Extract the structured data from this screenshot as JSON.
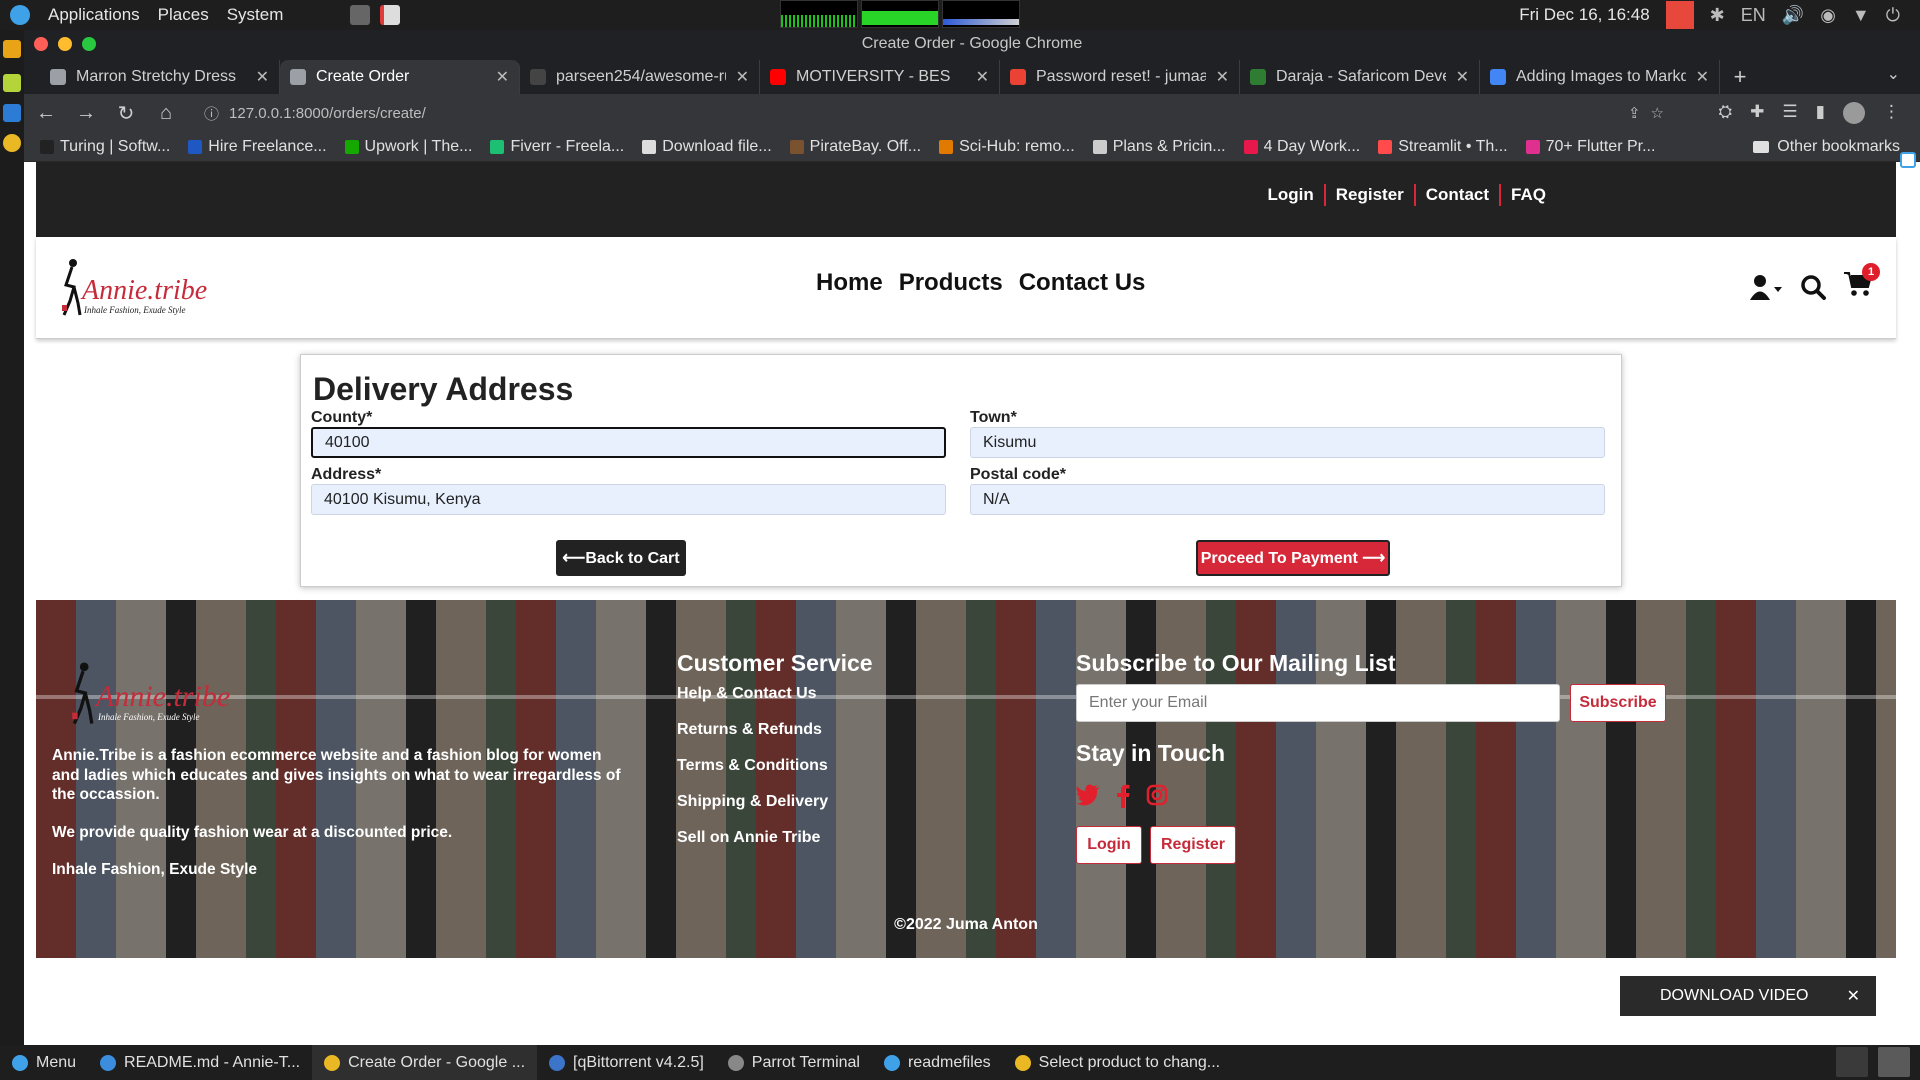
{
  "os_panel": {
    "menu": [
      "Applications",
      "Places",
      "System"
    ],
    "clock": "Fri Dec 16, 16:48",
    "lang": "EN"
  },
  "window": {
    "title": "Create Order - Google Chrome"
  },
  "tabs": [
    {
      "label": "Marron Stretchy Dress",
      "active": false,
      "color": "#9aa0a6"
    },
    {
      "label": "Create Order",
      "active": true,
      "color": "#9aa0a6"
    },
    {
      "label": "parseen254/awesome-ru",
      "active": false,
      "color": "#444444"
    },
    {
      "label": "MOTIVERSITY - BES",
      "active": false,
      "color": "#ff0000"
    },
    {
      "label": "Password reset! - jumaa",
      "active": false,
      "color": "#ea4335"
    },
    {
      "label": "Daraja - Safaricom Devel",
      "active": false,
      "color": "#2e7d32"
    },
    {
      "label": "Adding Images to Markd",
      "active": false,
      "color": "#4285f4"
    }
  ],
  "address_bar": {
    "url": "127.0.0.1:8000/orders/create/"
  },
  "bookmarks": [
    {
      "label": "Turing | Softw...",
      "color": "#222222"
    },
    {
      "label": "Hire Freelance...",
      "color": "#1f57c3"
    },
    {
      "label": "Upwork | The...",
      "color": "#14a800"
    },
    {
      "label": "Fiverr - Freela...",
      "color": "#1dbf73"
    },
    {
      "label": "Download file...",
      "color": "#dddddd"
    },
    {
      "label": "PirateBay. Off...",
      "color": "#7a5230"
    },
    {
      "label": "Sci-Hub: remo...",
      "color": "#e07a00"
    },
    {
      "label": "Plans & Pricin...",
      "color": "#cccccc"
    },
    {
      "label": "4 Day Work...",
      "color": "#e8174c"
    },
    {
      "label": "Streamlit • Th...",
      "color": "#ff4b4b"
    },
    {
      "label": "70+ Flutter Pr...",
      "color": "#e0308f"
    }
  ],
  "other_bookmarks": "Other bookmarks",
  "site": {
    "top_links": [
      "Login",
      "Register",
      "Contact",
      "FAQ"
    ],
    "logo_text": "Annie.tribe",
    "logo_tagline": "Inhale Fashion, Exude Style",
    "main_nav": [
      "Home",
      "Products",
      "Contact Us"
    ],
    "cart_count": "1",
    "accent_color": "#d7283a"
  },
  "form": {
    "heading": "Delivery Address",
    "county_label": "County*",
    "county_value": "40100",
    "town_label": "Town*",
    "town_value": "Kisumu",
    "address_label": "Address*",
    "address_value": "40100 Kisumu, Kenya",
    "postal_label": "Postal code*",
    "postal_value": "N/A",
    "back_button": "Back to Cart",
    "proceed_button": "Proceed To Payment"
  },
  "footer": {
    "about_p1": "Annie.Tribe is a fashion ecommerce website and a fashion blog for women and ladies which educates and gives insights on what to wear irregardless of the occassion.",
    "about_p2": "We provide quality fashion wear at a discounted price.",
    "about_p3": "Inhale Fashion, Exude Style",
    "cs_title": "Customer Service",
    "cs_links": [
      "Help & Contact Us",
      "Returns & Refunds",
      "Terms & Conditions",
      "Shipping & Delivery",
      "Sell on Annie Tribe"
    ],
    "subscribe_title": "Subscribe to Our Mailing List",
    "email_placeholder": "Enter your Email",
    "subscribe_button": "Subscribe",
    "stay_title": "Stay in Touch",
    "login_button": "Login",
    "register_button": "Register",
    "copyright": "©2022 Juma Anton"
  },
  "download_pill": {
    "label": "DOWNLOAD VIDEO"
  },
  "taskbar": {
    "menu": "Menu",
    "items": [
      {
        "label": "README.md - Annie-T...",
        "color": "#3c8dde"
      },
      {
        "label": "Create Order - Google ...",
        "color": "#e9b824",
        "active": true
      },
      {
        "label": "[qBittorrent v4.2.5]",
        "color": "#3b74c9"
      },
      {
        "label": "Parrot Terminal",
        "color": "#888888"
      },
      {
        "label": "readmefiles",
        "color": "#3fa2e8"
      },
      {
        "label": "Select product to chang...",
        "color": "#e9b824"
      }
    ]
  }
}
